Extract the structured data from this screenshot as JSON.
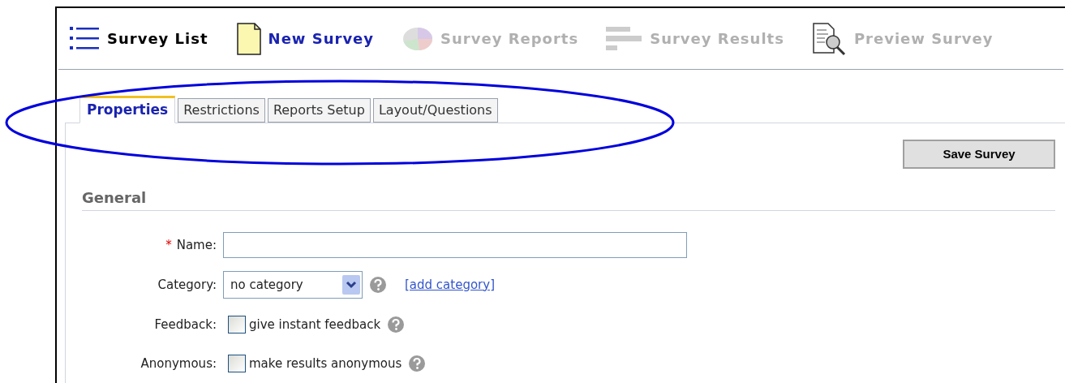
{
  "toolbar": [
    {
      "label": "Survey List",
      "selected": false,
      "disabled": false
    },
    {
      "label": "New Survey",
      "selected": true,
      "disabled": false
    },
    {
      "label": "Survey Reports",
      "selected": false,
      "disabled": true
    },
    {
      "label": "Survey Results",
      "selected": false,
      "disabled": true
    },
    {
      "label": "Preview Survey",
      "selected": false,
      "disabled": true
    }
  ],
  "tabs": [
    {
      "label": "Properties",
      "selected": true
    },
    {
      "label": "Restrictions",
      "selected": false
    },
    {
      "label": "Reports Setup",
      "selected": false
    },
    {
      "label": "Layout/Questions",
      "selected": false
    }
  ],
  "save_button": "Save Survey",
  "section_title": "General",
  "fields": [
    {
      "kind": "text",
      "label": "Name:",
      "required_mark": "*"
    },
    {
      "kind": "select",
      "label": "Category:",
      "value": "no category",
      "help": true,
      "link": "[add category]"
    },
    {
      "kind": "checkbox",
      "label": "Feedback:",
      "option": "give instant feedback",
      "checked": false,
      "help": true
    },
    {
      "kind": "checkbox",
      "label": "Anonymous:",
      "option": "make results anonymous",
      "checked": false,
      "help": true
    }
  ],
  "annotation": {
    "kind": "ellipse",
    "color": "#0000dd"
  }
}
